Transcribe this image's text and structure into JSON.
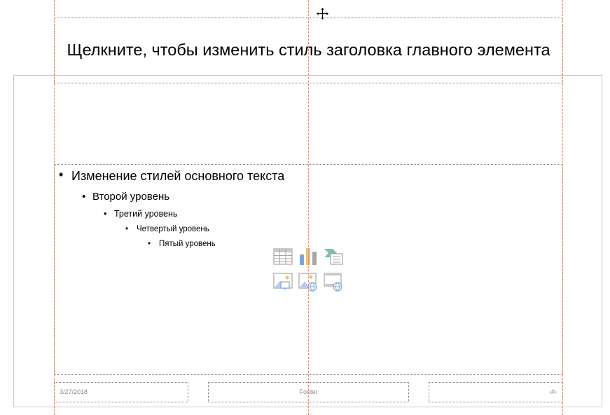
{
  "slide": {
    "title_placeholder": "Щелкните, чтобы изменить стиль заголовка главного элемента",
    "body_levels": [
      "Изменение стилей основного текста",
      "Второй уровень",
      "Третий уровень",
      "Четвертый уровень",
      "Пятый уровень"
    ],
    "footer": {
      "date": "3/27/2018",
      "footer_text": "Footer",
      "slide_number": "‹#›"
    }
  },
  "content_icons": [
    "table-icon",
    "chart-icon",
    "smartart-icon",
    "picture-icon",
    "online-picture-icon",
    "video-icon"
  ],
  "colors": {
    "guide": "#d98a7a",
    "placeholder_border": "#7a7a7a",
    "icon_gray": "#a7a7a7",
    "icon_blue": "#7fa6d8",
    "icon_gold": "#e8c27a",
    "icon_green": "#7fbfa6"
  }
}
